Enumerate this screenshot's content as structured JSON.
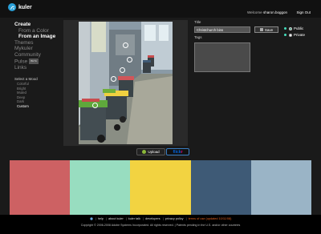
{
  "header": {
    "logo_text": "kuler",
    "welcome_prefix": "Welcome",
    "username": "sharon.boggon",
    "sign_out": "Sign Out"
  },
  "nav": {
    "create": "Create",
    "from_color": "From a Color",
    "from_image": "From an Image",
    "themes": "Themes",
    "mykuler": "Mykuler",
    "community": "Community",
    "pulse": "Pulse",
    "pulse_badge": "BETA",
    "links": "Links"
  },
  "mood": {
    "title": "Select a Mood",
    "items": [
      "Colorful",
      "Bright",
      "Muted",
      "Deep",
      "Dark",
      "Custom"
    ],
    "active": "Custom"
  },
  "image_panel": {
    "upload_label": "Upload",
    "flickr_part1": "flick",
    "flickr_part2": "r"
  },
  "form": {
    "title_label": "Title",
    "title_value": "Christchurch bins",
    "save_label": "Save",
    "public_label": "Public",
    "private_label": "Private",
    "visibility": "Public",
    "tags_label": "Tags"
  },
  "swatch_colors": [
    "#cd6163",
    "#98ddc0",
    "#f2d341",
    "#3e5a76",
    "#9ab4c6"
  ],
  "footer": {
    "help": "help",
    "about": "about kuler",
    "talk": "kuler talk",
    "developers": "developers",
    "privacy": "privacy policy",
    "terms": "terms of use (updated 10/11/08)",
    "copyright": "Copyright © 2006-2008 Adobe Systems Incorporated. All rights reserved. | Patents pending in the U.S. and/or other countries"
  }
}
